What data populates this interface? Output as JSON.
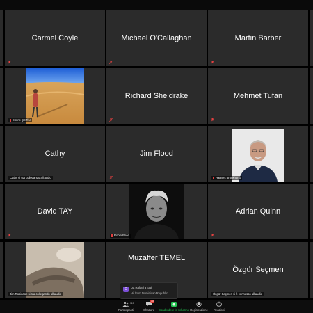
{
  "tiles": [
    {
      "name": "Carmel Coyle",
      "label": ""
    },
    {
      "name": "Michael O'Callaghan",
      "label": ""
    },
    {
      "name": "Martin Barber",
      "label": ""
    },
    {
      "name": "",
      "label": "Emine ÇETİN"
    },
    {
      "name": "Richard Sheldrake",
      "label": ""
    },
    {
      "name": "Mehmet Tufan",
      "label": ""
    },
    {
      "name": "Cathy",
      "label": "Cathy si sta collegando all'audio"
    },
    {
      "name": "Jim Flood",
      "label": ""
    },
    {
      "name": "",
      "label": "Hannes Bronkhorst"
    },
    {
      "name": "David TAY",
      "label": ""
    },
    {
      "name": "",
      "label": "Robin Price"
    },
    {
      "name": "Adrian Quinn",
      "label": ""
    },
    {
      "name": "",
      "label": "Jim Robinson si sta collegando all'audio"
    },
    {
      "name": "Muzaffer TEMEL",
      "label": ""
    },
    {
      "name": "Özgür Seçmen",
      "label": "Özgür Seçmen si è connesso all'audio"
    }
  ],
  "chat": {
    "avatar": "D",
    "from": "Da Rafael a tutti",
    "message": "Hi, from Dominican Republic..."
  },
  "toolbar": {
    "participants_count": "115",
    "participants": "Partecipanti",
    "chat": "Chattare",
    "chat_badge": "10",
    "share": "Condividere lo schermo",
    "record": "Registrazione",
    "reactions": "Reazioni"
  },
  "colors": {
    "tile": "#2b2b2b",
    "share_green": "#23c552",
    "mic_muted": "#e34040",
    "chat_avatar": "#7b4fd6"
  }
}
